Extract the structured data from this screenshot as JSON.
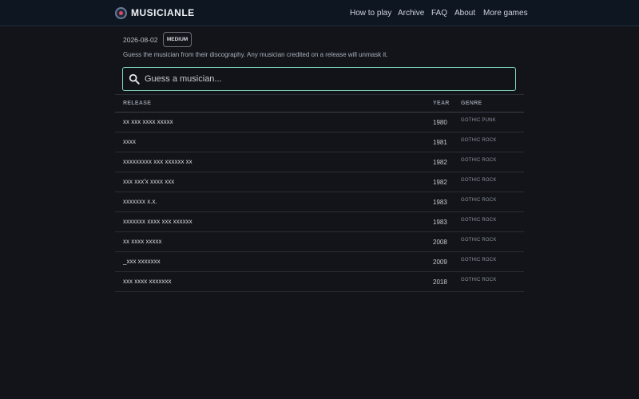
{
  "app": {
    "brand": "MUSICIANLE"
  },
  "nav": {
    "links": [
      "How to play",
      "Archive",
      "FAQ",
      "About",
      "More games"
    ]
  },
  "puzzle": {
    "date": "2026-08-02",
    "difficulty": "MEDIUM",
    "intro": "Guess the musician from their discography. Any musician credited on a release will unmask it."
  },
  "search": {
    "placeholder": "Guess a musician..."
  },
  "table": {
    "headers": {
      "release": "RELEASE",
      "year": "YEAR",
      "genre": "GENRE"
    },
    "rows": [
      {
        "release": "xx xxx xxxx xxxxx",
        "year": "1980",
        "genre": "GOTHIC PUNK"
      },
      {
        "release": "xxxx",
        "year": "1981",
        "genre": "GOTHIC ROCK"
      },
      {
        "release": "xxxxxxxxx xxx xxxxxx xx",
        "year": "1982",
        "genre": "GOTHIC ROCK"
      },
      {
        "release": "xxx xxx'x xxxx xxx",
        "year": "1982",
        "genre": "GOTHIC ROCK"
      },
      {
        "release": "xxxxxxx x.x.",
        "year": "1983",
        "genre": "GOTHIC ROCK"
      },
      {
        "release": "xxxxxxx xxxx xxx xxxxxx",
        "year": "1983",
        "genre": "GOTHIC ROCK"
      },
      {
        "release": "xx xxxx xxxxx",
        "year": "2008",
        "genre": "GOTHIC ROCK"
      },
      {
        "release": "_xxx xxxxxxx",
        "year": "2009",
        "genre": "GOTHIC ROCK"
      },
      {
        "release": "xxx xxxx xxxxxxx",
        "year": "2018",
        "genre": "GOTHIC ROCK"
      }
    ]
  },
  "colors": {
    "accent": "#7fd9bb",
    "logo_dot": "#e0475e",
    "background": "#121419",
    "nav_background": "#0d1621"
  },
  "icons": {
    "logo": "vinyl-record-icon",
    "search": "search-icon"
  }
}
